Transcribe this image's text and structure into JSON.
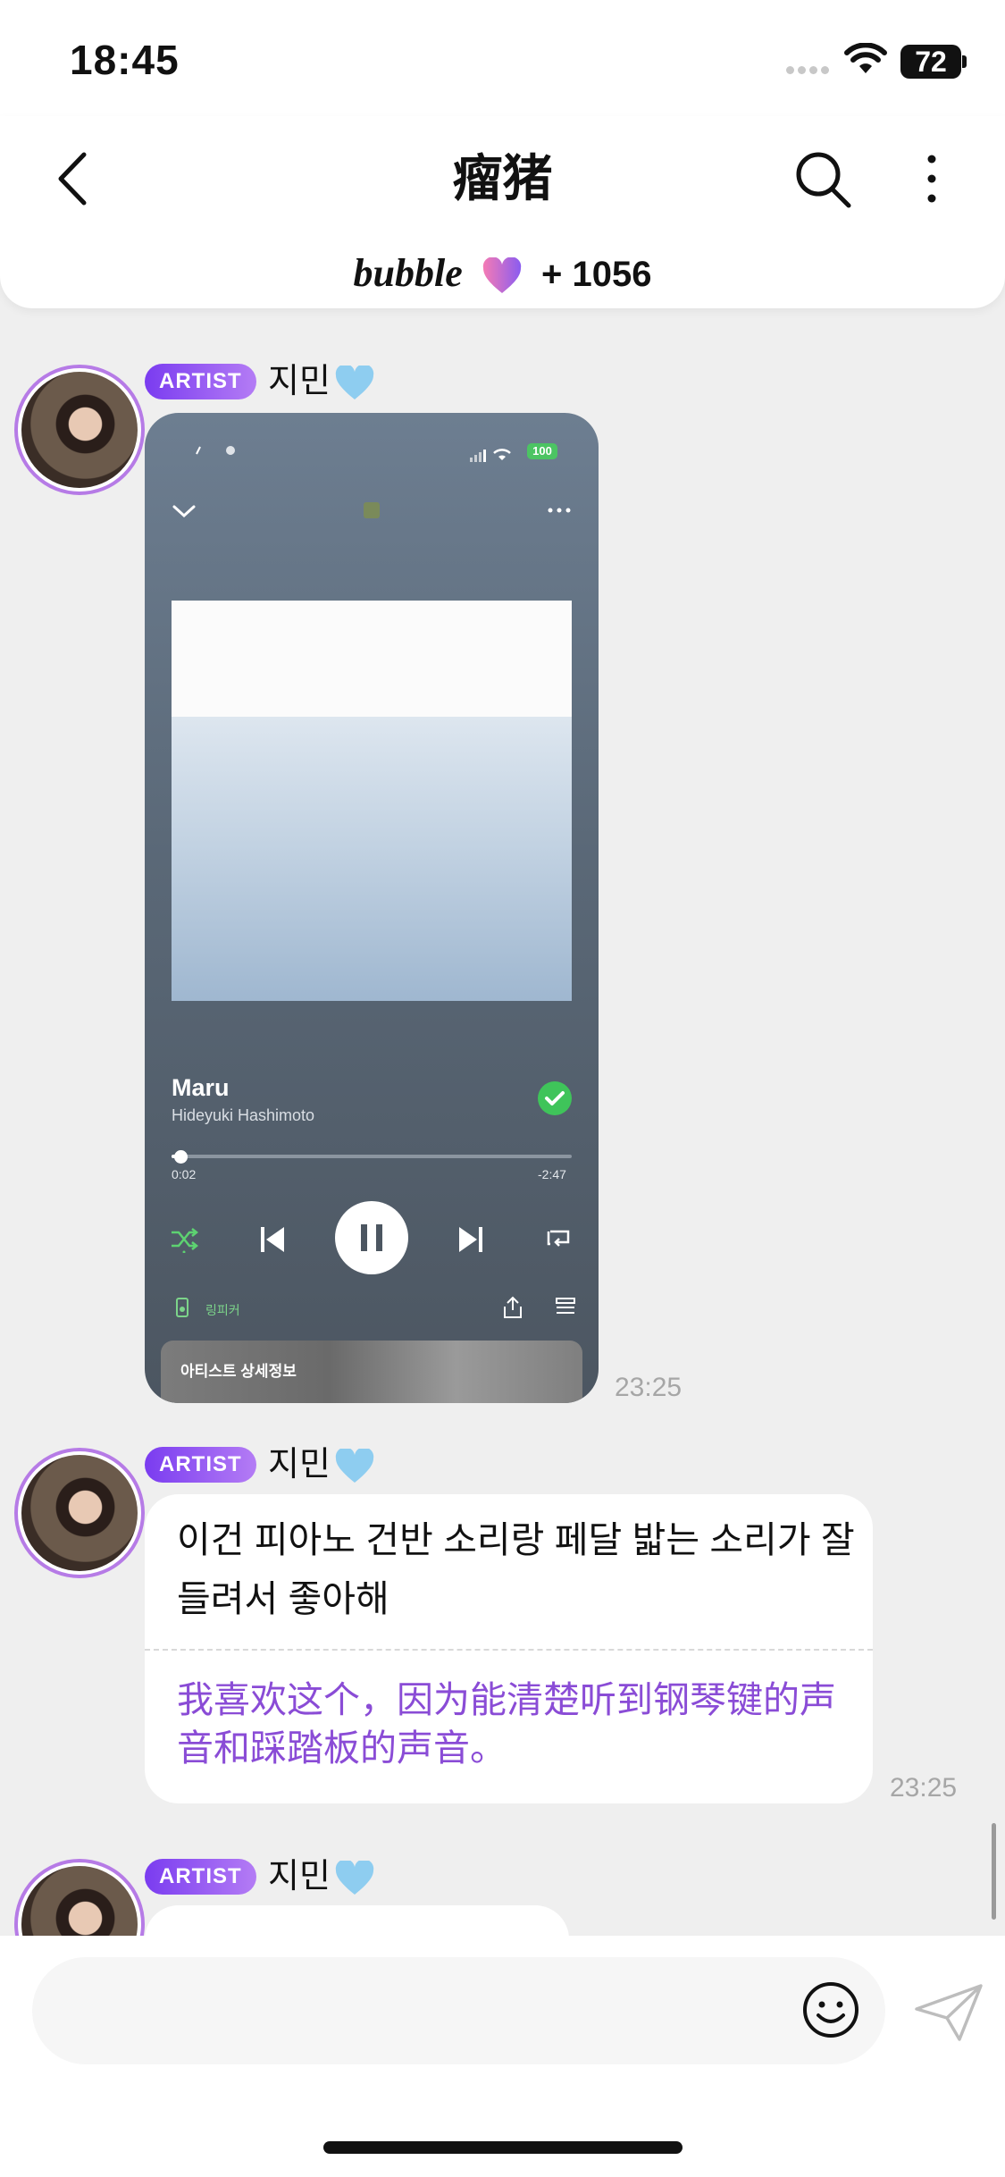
{
  "status_bar": {
    "time": "18:45",
    "battery": "72",
    "icons": [
      "signal-dots-icon",
      "wifi-icon",
      "battery-icon"
    ]
  },
  "header": {
    "title": "瘤猪",
    "brand": "bubble",
    "count_text": "+ 1056",
    "icons": [
      "back-arrow-icon",
      "search-icon",
      "more-vertical-icon",
      "heart-icon"
    ]
  },
  "messages": [
    {
      "badge": "ARTIST",
      "sender": "지민",
      "type": "image",
      "time": "23:25",
      "music_player": {
        "battery": "100",
        "song_title": "Maru",
        "artist": "Hideyuki Hashimoto",
        "elapsed": "0:02",
        "remaining": "-2:47",
        "progress_fraction": 0.012,
        "speaker_label": "링피커",
        "artist_info_label": "아티스트 상세정보",
        "icons": [
          "chevron-down-icon",
          "more-horizontal-icon",
          "check-icon",
          "shuffle-icon",
          "previous-icon",
          "pause-icon",
          "next-icon",
          "repeat-icon",
          "speaker-icon",
          "share-icon",
          "queue-icon"
        ]
      }
    },
    {
      "badge": "ARTIST",
      "sender": "지민",
      "type": "text",
      "time": "23:25",
      "text": "이건 피아노 건반 소리랑 페달 밟는 소리가 잘 들려서 좋아해",
      "translation": "我喜欢这个，因为能清楚听到钢琴键的声音和踩踏板的声音。"
    },
    {
      "badge": "ARTIST",
      "sender": "지민",
      "type": "text"
    }
  ],
  "colors": {
    "accent": "#8a4cd6",
    "badge_start": "#7a3cf0",
    "badge_end": "#b47cf5"
  },
  "input": {
    "icons": [
      "emoji-icon",
      "send-icon"
    ]
  }
}
